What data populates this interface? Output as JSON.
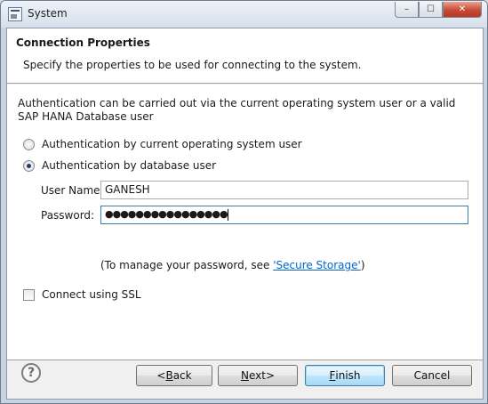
{
  "window": {
    "title": "System",
    "minimize_label": "–",
    "maximize_label": "☐",
    "close_label": "✕"
  },
  "header": {
    "title": "Connection Properties",
    "description": "Specify the properties to be used for connecting to the system."
  },
  "auth": {
    "intro": "Authentication can be carried out via the current operating system user or a valid SAP HANA Database user",
    "option_os_label": "Authentication by current operating system user",
    "option_db_label": "Authentication by database user",
    "selected": "database user"
  },
  "fields": {
    "username_label": "User Name:",
    "username_value": "GANESH",
    "password_label": "Password:",
    "password_value": "●●●●●●●●●●●●●●●●"
  },
  "hint": {
    "prefix": "(To manage your password, see ",
    "link": "'Secure Storage'",
    "suffix": ")"
  },
  "ssl": {
    "label": "Connect using SSL",
    "checked": false
  },
  "footer": {
    "help_label": "?",
    "back_label": "Back",
    "back_prefix": "< ",
    "back_mnemonic": "B",
    "back_rest": "ack",
    "next_mnemonic": "N",
    "next_rest": "ext",
    "next_suffix": " >",
    "finish_mnemonic": "F",
    "finish_rest": "inish",
    "cancel_label": "Cancel"
  }
}
